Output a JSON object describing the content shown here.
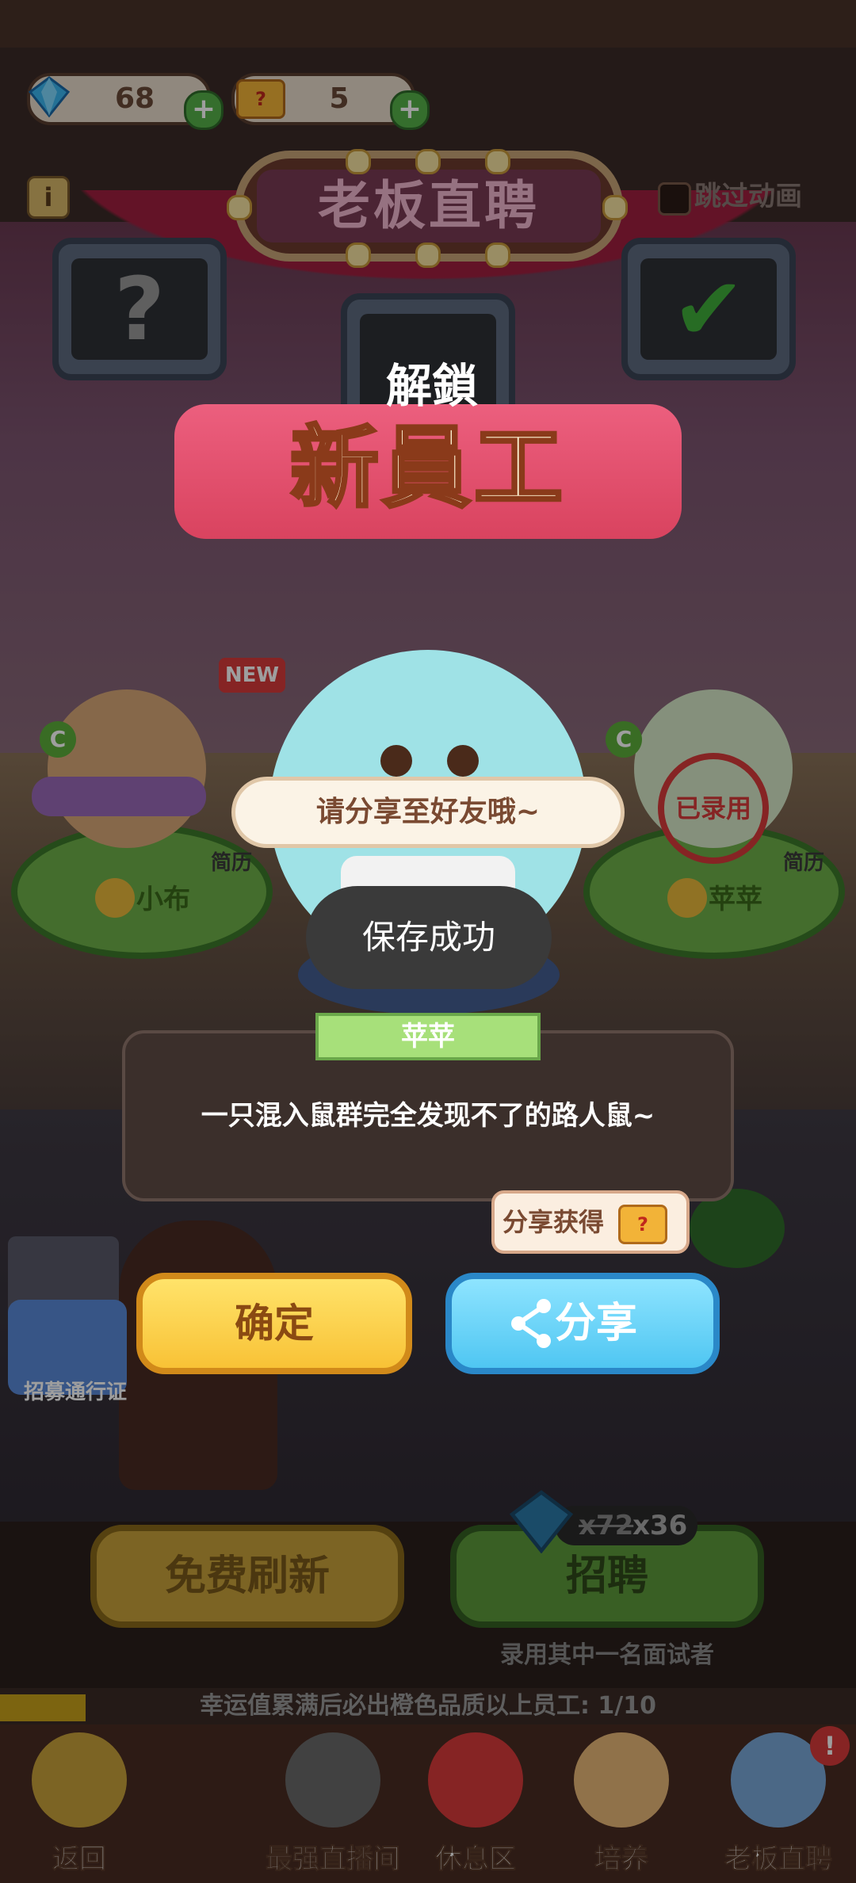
{
  "resources": {
    "gems": "68",
    "tickets": "5"
  },
  "header": {
    "title": "老板直聘",
    "skip_animation_label": "跳过动画"
  },
  "banner": {
    "line1": "解鎖",
    "line2": "新員工"
  },
  "candidates": [
    {
      "name": "小布",
      "badge": "NEW",
      "resume_label": "简历"
    },
    {
      "name": "苹苹",
      "resume_label": "简历",
      "stamp": "已录用"
    }
  ],
  "share_prompt": "请分享至好友哦~",
  "toast": "保存成功",
  "unlocked_employee": {
    "name": "苹苹",
    "description": "一只混入鼠群完全发现不了的路人鼠~"
  },
  "reward_tip": "分享获得",
  "buttons": {
    "confirm": "确定",
    "share": "分享",
    "free_refresh": "免费刷新",
    "hire": "招聘"
  },
  "hire_cost": {
    "old": "x72",
    "new": "x36"
  },
  "hire_subtitle": "录用其中一名面试者",
  "recruit_pass": "招募通行证",
  "luck_progress": {
    "text": "幸运值累满后必出橙色品质以上员工: 1/10",
    "fraction": 0.1
  },
  "bottom_nav": [
    {
      "label": "返回"
    },
    {
      "label": "最强直播间"
    },
    {
      "label": "休息区"
    },
    {
      "label": "培养"
    },
    {
      "label": "老板直聘"
    }
  ],
  "colors": {
    "confirm_button": "#f8c236",
    "share_button": "#4fc6f2",
    "toast_bg": "#3a3a3a",
    "banner": "#d9435f"
  }
}
